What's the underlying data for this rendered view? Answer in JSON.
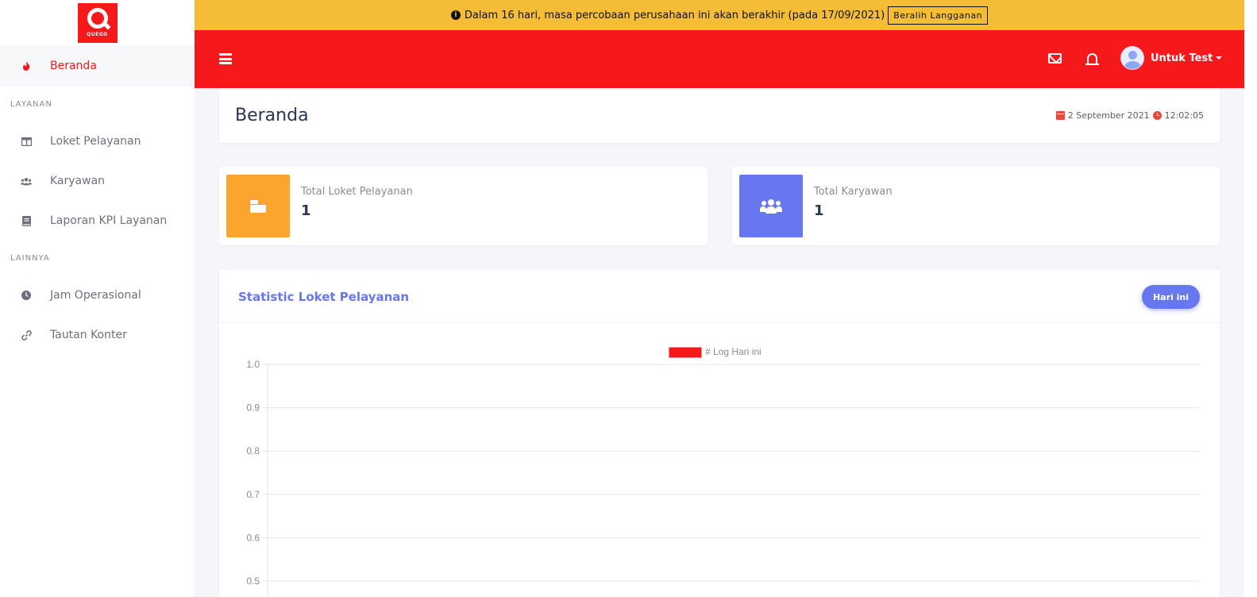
{
  "colors": {
    "brand_red": "#f5191c",
    "banner_yellow": "#f4bd35",
    "accent_purple": "#6777ef",
    "orange": "#fba52f"
  },
  "logo": {
    "text": "QUEGO"
  },
  "sidebar": {
    "active": {
      "label": "Beranda",
      "icon": "fire-icon"
    },
    "sections": [
      {
        "heading": "LAYANAN",
        "items": [
          {
            "label": "Loket Pelayanan",
            "icon": "table-columns-icon"
          },
          {
            "label": "Karyawan",
            "icon": "users-icon"
          },
          {
            "label": "Laporan KPI Layanan",
            "icon": "book-icon"
          }
        ]
      },
      {
        "heading": "LAINNYA",
        "items": [
          {
            "label": "Jam Operasional",
            "icon": "clock-icon"
          },
          {
            "label": "Tautan Konter",
            "icon": "link-icon"
          }
        ]
      }
    ]
  },
  "banner": {
    "text": "Dalam 16 hari, masa percobaan perusahaan ini akan berakhir (pada 17/09/2021)",
    "button": "Beralih Langganan"
  },
  "topbar": {
    "user_name": "Untuk Test"
  },
  "page": {
    "title": "Beranda",
    "date": "2 September 2021",
    "time": "12:02:05"
  },
  "stats": [
    {
      "label": "Total Loket Pelayanan",
      "value": "1",
      "icon": "cash-register-icon"
    },
    {
      "label": "Total Karyawan",
      "value": "1",
      "icon": "users-icon"
    }
  ],
  "statistic": {
    "title": "Statistic Loket Pelayanan",
    "filter_button": "Hari ini"
  },
  "chart_data": {
    "type": "bar",
    "categories": [],
    "series": [
      {
        "name": "# Log Hari ini",
        "color": "#f5191c",
        "values": []
      }
    ],
    "ylim": [
      0,
      1.0
    ],
    "yticks_visible": [
      "1.0",
      "0.9",
      "0.8",
      "0.7",
      "0.6",
      "0.5"
    ],
    "grid": true,
    "legend": "top-center"
  }
}
